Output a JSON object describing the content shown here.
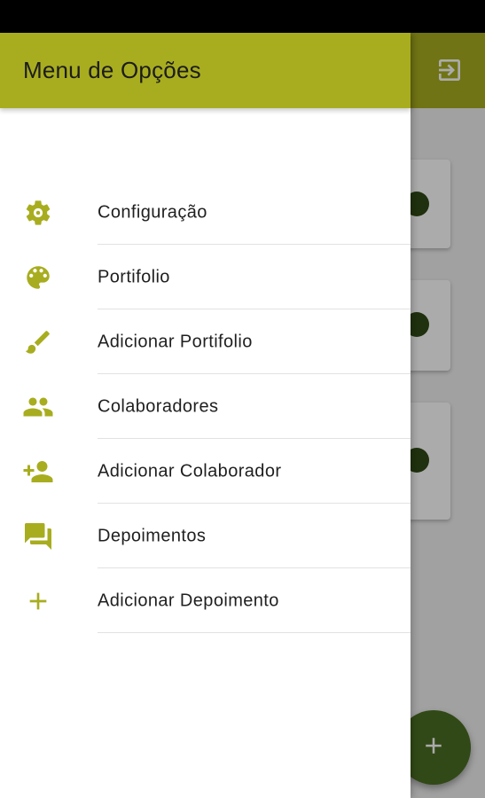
{
  "colors": {
    "accent": "#a8ad1f",
    "dark_green": "#2f4a16",
    "status_bar": "#000000"
  },
  "drawer": {
    "title": "Menu de Opções",
    "items": [
      {
        "label": "Configuração",
        "icon": "gear-icon"
      },
      {
        "label": "Portifolio",
        "icon": "palette-icon"
      },
      {
        "label": "Adicionar Portifolio",
        "icon": "brush-icon"
      },
      {
        "label": "Colaboradores",
        "icon": "people-icon"
      },
      {
        "label": "Adicionar Colaborador",
        "icon": "person-add-icon"
      },
      {
        "label": "Depoimentos",
        "icon": "chat-icon"
      },
      {
        "label": "Adicionar Depoimento",
        "icon": "plus-icon"
      }
    ]
  },
  "background_app": {
    "toolbar_action_icon": "logout-icon",
    "fab_icon": "add-icon"
  }
}
